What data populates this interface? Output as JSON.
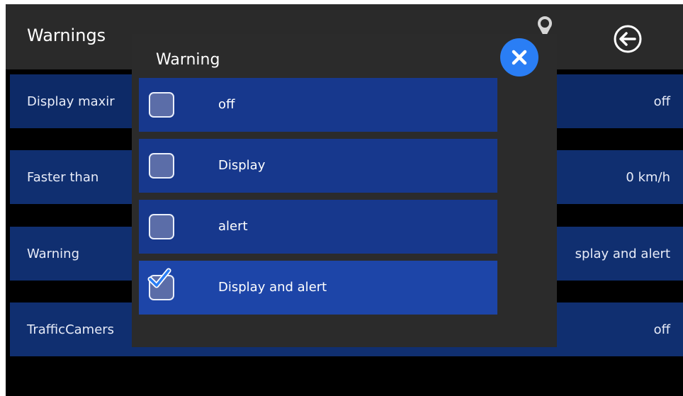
{
  "header": {
    "title": "Warnings"
  },
  "settings_rows": [
    {
      "label": "Display maxir",
      "value": "off"
    },
    {
      "label": "Faster than",
      "value": "0 km/h"
    },
    {
      "label": "Warning",
      "value": "splay and alert"
    },
    {
      "label": "TrafficCamers",
      "value": "off"
    }
  ],
  "modal": {
    "title": "Warning",
    "options": [
      {
        "label": "off",
        "checked": false
      },
      {
        "label": "Display",
        "checked": false
      },
      {
        "label": "alert",
        "checked": false
      },
      {
        "label": "Display and alert",
        "checked": true
      }
    ]
  },
  "colors": {
    "screen_background": "#000000",
    "header_background": "#2a2a2a",
    "row_background": "#102b66",
    "modal_background": "#2b2b2b",
    "option_background": "#17388d",
    "selected_option_background": "#1d45a8",
    "close_button": "#2a7ef5",
    "checkmark": "#2a7ef5"
  },
  "icons": {
    "back": "circle-arrow-left-icon",
    "close": "close-icon",
    "location": "location-pin-icon",
    "checked": "checkmark-icon"
  }
}
